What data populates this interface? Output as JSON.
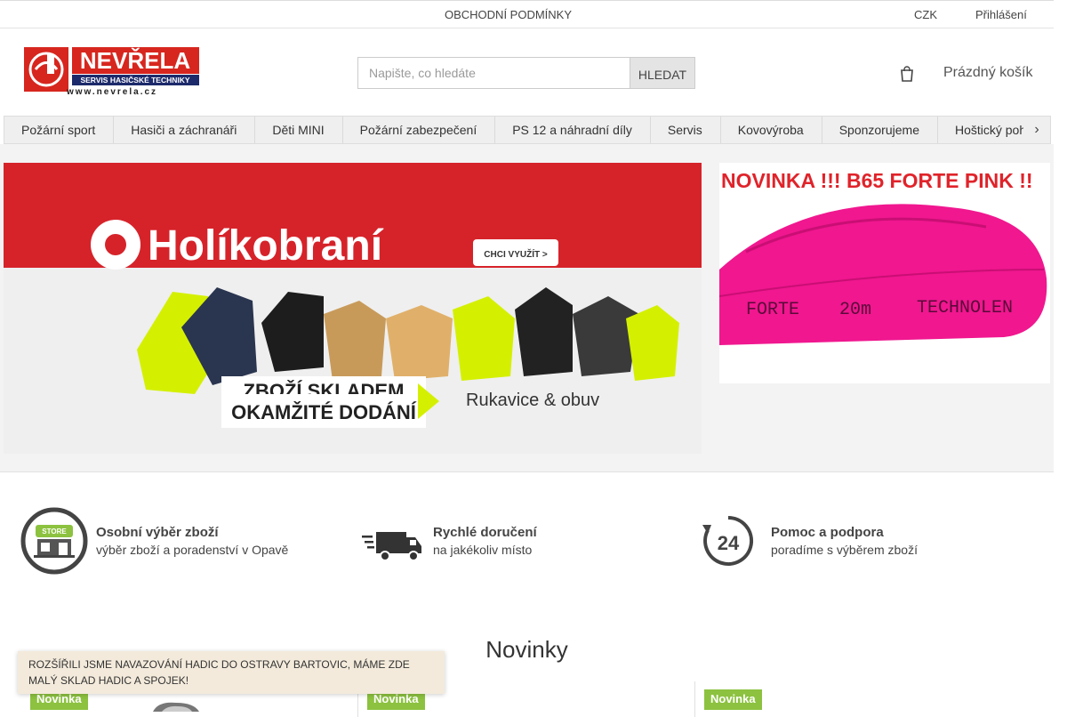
{
  "topbar": {
    "terms_link": "OBCHODNÍ PODMÍNKY",
    "chevron": "",
    "currency": "CZK",
    "currency_chevron": "",
    "login": "Přihlášení"
  },
  "header": {
    "logo_title": "NEVŘELA",
    "logo_subtitle": "SERVIS HASIČSKÉ TECHNIKY",
    "logo_url": "www.nevrela.cz",
    "search_placeholder": "Napište, co hledáte",
    "search_button": "HLEDAT",
    "cart_label": "Prázdný košík"
  },
  "menu": {
    "items": [
      "Požární sport",
      "Hasiči a záchranáři",
      "Děti MINI",
      "Požární zabezpečení",
      "PS 12 a náhradní díly",
      "Servis",
      "Kovovýroba",
      "Sponzorujeme",
      "Hoštický pohár"
    ],
    "more_icon": "chevron-right-icon"
  },
  "banner_main": {
    "brand": "Holíkobraní",
    "cta": "CHCI VYUŽÍT >",
    "line1": "ZBOŽÍ SKLADEM",
    "line2": "OKAMŽITÉ DODÁNÍ",
    "side_text": "Rukavice & obuv"
  },
  "banner_side": {
    "headline": "NOVINKA !!! B65 FORTE PINK !!",
    "hose_text_1": "FORTE",
    "hose_text_2": "20m",
    "hose_text_3": "TECHNOLEN"
  },
  "benefits": [
    {
      "icon": "store-icon",
      "store_label": "STORE",
      "title": "Osobní výběr zboží",
      "subtitle": "výběr zboží a poradenství v Opavě"
    },
    {
      "icon": "delivery-truck-icon",
      "title": "Rychlé doručení",
      "subtitle": "na jakékoliv místo"
    },
    {
      "icon": "support-24-icon",
      "digits": "24",
      "title": "Pomoc a podpora",
      "subtitle": "poradíme s výběrem zboží"
    }
  ],
  "news": {
    "title": "Novinky",
    "badges": [
      "Novinka",
      "Novinka",
      "Novinka"
    ]
  },
  "notice": {
    "text": "ROZŠÍŘILI JSME NAVAZOVÁNÍ HADIC DO OSTRAVY BARTOVIC, MÁME ZDE MALÝ SKLAD HADIC A SPOJEK!",
    "close": ""
  },
  "colors": {
    "brand_red": "#d7261e",
    "badge_green": "#8cc23f",
    "banner_red": "#d6232a",
    "pink": "#f0178f",
    "yellow": "#d4f000"
  }
}
